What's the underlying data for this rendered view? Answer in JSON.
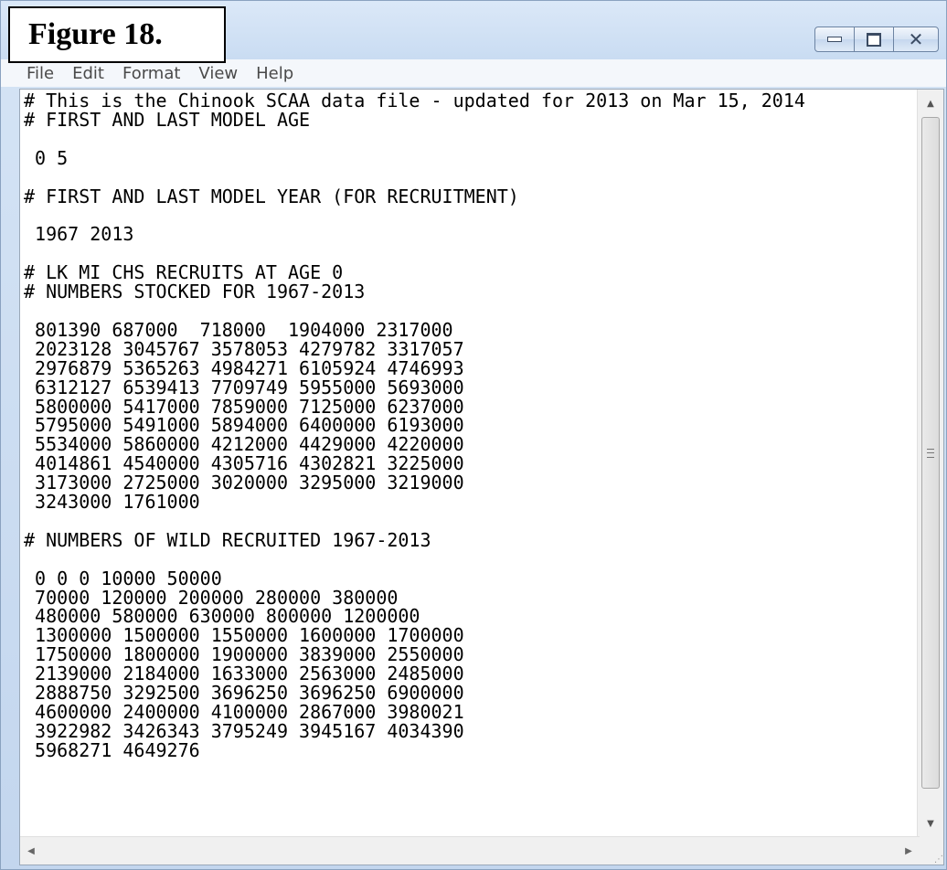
{
  "figure_label": "Figure 18.",
  "window": {
    "minimize_icon": "minimize-icon",
    "maximize_icon": "maximize-icon",
    "close_icon": "close-icon"
  },
  "menu": [
    "File",
    "Edit",
    "Format",
    "View",
    "Help"
  ],
  "editor": {
    "lines": [
      "# This is the Chinook SCAA data file - updated for 2013 on Mar 15, 2014",
      "# FIRST AND LAST MODEL AGE",
      "",
      " 0 5",
      "",
      "# FIRST AND LAST MODEL YEAR (FOR RECRUITMENT)",
      "",
      " 1967 2013",
      "",
      "# LK MI CHS RECRUITS AT AGE 0",
      "# NUMBERS STOCKED FOR 1967-2013",
      "",
      " 801390 687000  718000  1904000 2317000",
      " 2023128 3045767 3578053 4279782 3317057",
      " 2976879 5365263 4984271 6105924 4746993",
      " 6312127 6539413 7709749 5955000 5693000",
      " 5800000 5417000 7859000 7125000 6237000",
      " 5795000 5491000 5894000 6400000 6193000",
      " 5534000 5860000 4212000 4429000 4220000",
      " 4014861 4540000 4305716 4302821 3225000",
      " 3173000 2725000 3020000 3295000 3219000",
      " 3243000 1761000",
      "",
      "# NUMBERS OF WILD RECRUITED 1967-2013",
      "",
      " 0 0 0 10000 50000",
      " 70000 120000 200000 280000 380000",
      " 480000 580000 630000 800000 1200000",
      " 1300000 1500000 1550000 1600000 1700000",
      " 1750000 1800000 1900000 3839000 2550000",
      " 2139000 2184000 1633000 2563000 2485000",
      " 2888750 3292500 3696250 3696250 6900000",
      " 4600000 2400000 4100000 2867000 3980021",
      " 3922982 3426343 3795249 3945167 4034390",
      " 5968271 4649276"
    ]
  },
  "scrollbar": {
    "up_arrow": "▲",
    "down_arrow": "▼",
    "left_arrow": "◀",
    "right_arrow": "▶"
  }
}
